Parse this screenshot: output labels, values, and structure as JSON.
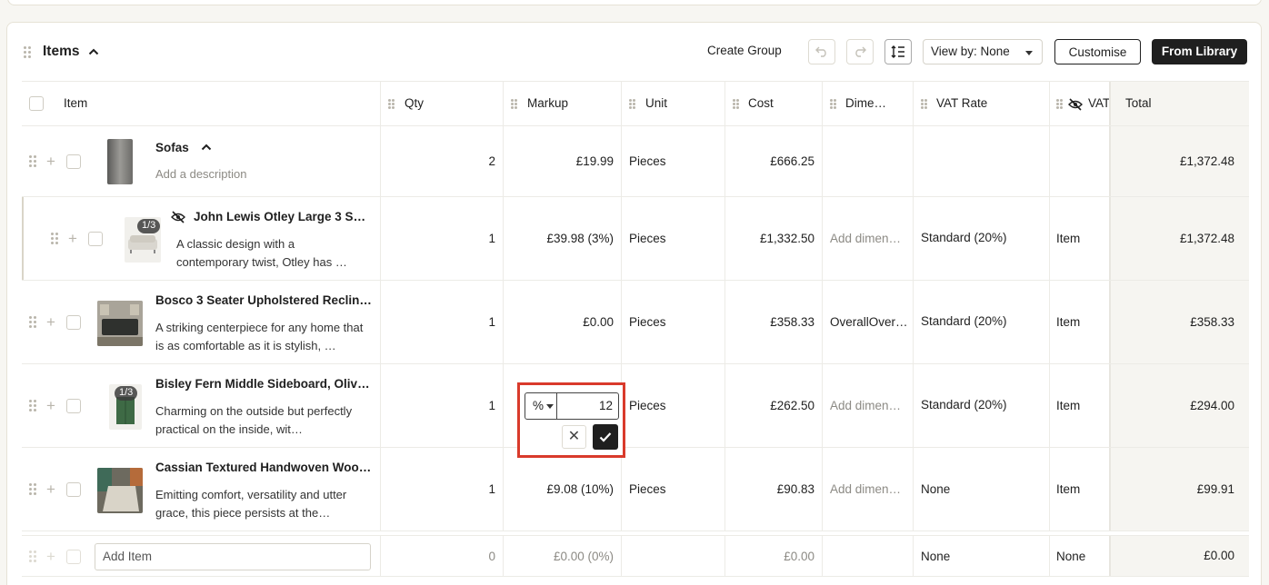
{
  "header": {
    "title": "Items",
    "create_group": "Create Group",
    "view_by": "View by: None",
    "customise": "Customise",
    "from_library": "From Library"
  },
  "columns": {
    "item": "Item",
    "qty": "Qty",
    "markup": "Markup",
    "unit": "Unit",
    "cost": "Cost",
    "dimensions": "Dime…",
    "vat_rate": "VAT Rate",
    "vat": "VAT",
    "total": "Total"
  },
  "rows": [
    {
      "name": "Sofas",
      "description": "Add a description",
      "qty": "2",
      "markup": "£19.99",
      "unit": "Pieces",
      "cost": "£666.25",
      "dimensions": "",
      "vat_rate": "",
      "vat": "",
      "total": "£1,372.48"
    },
    {
      "badge": "1/3",
      "name": "John Lewis Otley Large 3 Se…",
      "description": "A classic design with a contemporary twist, Otley has …",
      "qty": "1",
      "markup": "£39.98 (3%)",
      "unit": "Pieces",
      "cost": "£1,332.50",
      "dimensions": "Add dimen…",
      "vat_rate": "Standard (20%)",
      "vat": "Item",
      "total": "£1,372.48"
    },
    {
      "name": "Bosco 3 Seater Upholstered Reclini…",
      "description": "A striking centerpiece for any home that is as comfortable as it is stylish, …",
      "qty": "1",
      "markup": "£0.00",
      "unit": "Pieces",
      "cost": "£358.33",
      "dimensions": "OverallOver…",
      "vat_rate": "Standard (20%)",
      "vat": "Item",
      "total": "£358.33"
    },
    {
      "badge": "1/3",
      "name": "Bisley Fern Middle Sideboard, Olive …",
      "description": "Charming on the outside but perfectly practical on the inside, wit…",
      "qty": "1",
      "markup": "",
      "unit": "Pieces",
      "cost": "£262.50",
      "dimensions": "Add dimen…",
      "vat_rate": "Standard (20%)",
      "vat": "Item",
      "total": "£294.00"
    },
    {
      "name": "Cassian Textured Handwoven Wool …",
      "description": "Emitting comfort, versatility and utter grace, this piece persists at the…",
      "qty": "1",
      "markup": "£9.08 (10%)",
      "unit": "Pieces",
      "cost": "£90.83",
      "dimensions": "Add dimen…",
      "vat_rate": "None",
      "vat": "Item",
      "total": "£99.91"
    }
  ],
  "markup_editor": {
    "mode": "%",
    "value": "12",
    "cancel": "✕"
  },
  "add_row": {
    "placeholder": "Add Item",
    "qty": "0",
    "markup": "£0.00 (0%)",
    "cost": "£0.00",
    "vat_rate": "None",
    "vat": "None",
    "total": "£0.00"
  },
  "colors": {
    "highlight": "#d93a2b",
    "primary": "#1f1f1f",
    "total_bg": "#f6f5f1"
  }
}
